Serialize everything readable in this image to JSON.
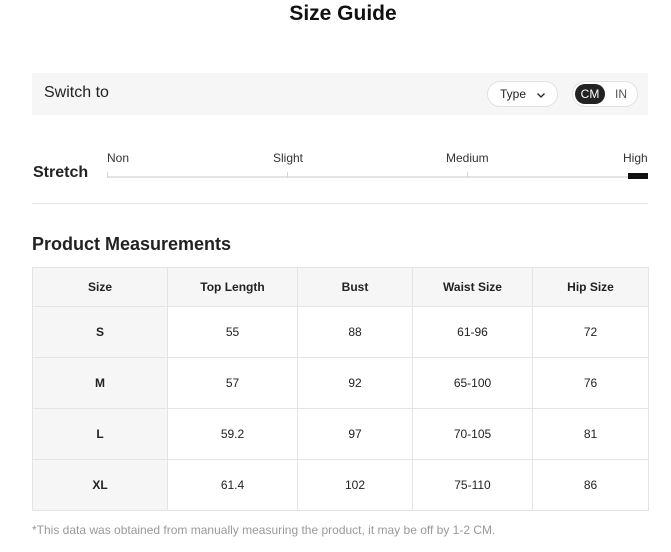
{
  "page": {
    "title": "Size Guide"
  },
  "switch_bar": {
    "label": "Switch to",
    "type_select": {
      "label": "Type",
      "icon": "chevron-down-icon"
    },
    "units": [
      {
        "label": "CM",
        "selected": true
      },
      {
        "label": "IN",
        "selected": false
      }
    ]
  },
  "stretch": {
    "label": "Stretch",
    "levels": [
      "Non",
      "Slight",
      "Medium",
      "High"
    ],
    "selected": "High"
  },
  "measurements": {
    "title": "Product Measurements",
    "columns": [
      "Size",
      "Top Length",
      "Bust",
      "Waist Size",
      "Hip Size"
    ],
    "rows": [
      [
        "S",
        "55",
        "88",
        "61-96",
        "72"
      ],
      [
        "M",
        "57",
        "92",
        "65-100",
        "76"
      ],
      [
        "L",
        "59.2",
        "97",
        "70-105",
        "81"
      ],
      [
        "XL",
        "61.4",
        "102",
        "75-110",
        "86"
      ]
    ]
  },
  "footnote": "*This data was obtained from manually measuring the product, it may be off by 1-2 CM."
}
